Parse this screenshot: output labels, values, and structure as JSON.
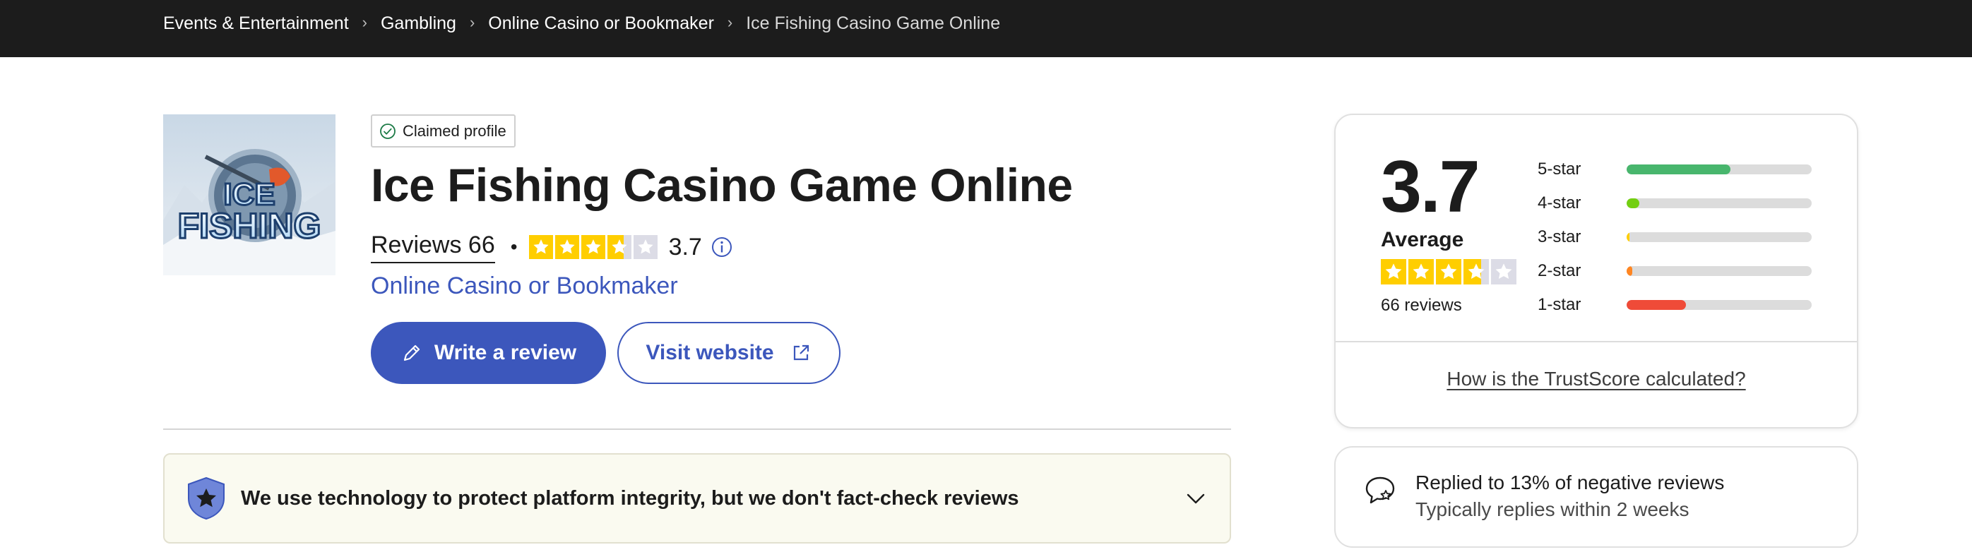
{
  "breadcrumb": {
    "items": [
      {
        "label": "Events & Entertainment"
      },
      {
        "label": "Gambling"
      },
      {
        "label": "Online Casino or Bookmaker"
      },
      {
        "label": "Ice Fishing Casino Game Online"
      }
    ]
  },
  "company": {
    "claimed_label": "Claimed profile",
    "name": "Ice Fishing Casino Game Online",
    "logo_text_line1": "ICE",
    "logo_text_line2": "FISHING",
    "reviews_label": "Reviews 66",
    "rating": "3.7",
    "rating_value": 3.7,
    "category": "Online Casino or Bookmaker"
  },
  "actions": {
    "write_review_label": "Write a review",
    "visit_website_label": "Visit website"
  },
  "notice": {
    "text": "We use technology to protect platform integrity, but we don't fact-check reviews"
  },
  "trustscore": {
    "score": "3.7",
    "label": "Average",
    "review_count": "66 reviews",
    "distribution": [
      {
        "label": "5-star",
        "fraction": 0.56,
        "color": "#48b66d"
      },
      {
        "label": "4-star",
        "fraction": 0.07,
        "color": "#73cf11"
      },
      {
        "label": "3-star",
        "fraction": 0.015,
        "color": "#ffce00"
      },
      {
        "label": "2-star",
        "fraction": 0.03,
        "color": "#ff8622"
      },
      {
        "label": "1-star",
        "fraction": 0.32,
        "color": "#ef4b38"
      }
    ],
    "how_link": "How is the TrustScore calculated?"
  },
  "reply_info": {
    "line1": "Replied to 13% of negative reviews",
    "line2": "Typically replies within 2 weeks"
  },
  "colors": {
    "brand_blue": "#3c57bc",
    "star_fill": "#ffce00",
    "star_empty": "#dcdce6",
    "topbar": "#1c1c1c"
  }
}
